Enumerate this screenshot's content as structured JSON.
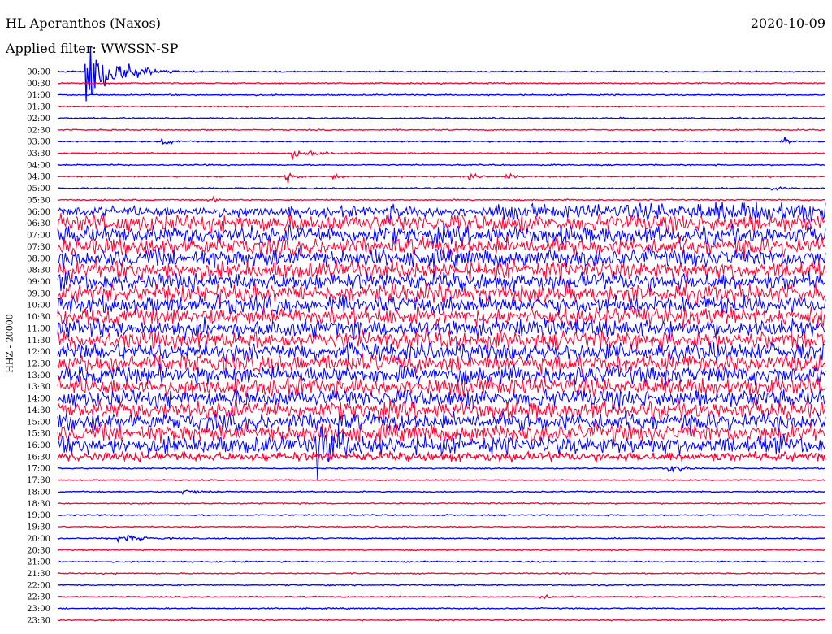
{
  "header": {
    "title": "HL Aperanthos (Naxos)",
    "filter_label": "Applied filter:",
    "filter_value": "WWSSN-SP",
    "date": "2020-10-09"
  },
  "chart_data": {
    "type": "line",
    "title": "HL Aperanthos (Naxos)",
    "date": "2020-10-09",
    "filter": "WWSSN-SP",
    "ylabel": "HHZ - 20000",
    "xlabel": "",
    "row_labels": [
      "00:00",
      "00:30",
      "01:00",
      "01:30",
      "02:00",
      "02:30",
      "03:00",
      "03:30",
      "04:00",
      "04:30",
      "05:00",
      "05:30",
      "06:00",
      "06:30",
      "07:00",
      "07:30",
      "08:00",
      "08:30",
      "09:00",
      "09:30",
      "10:00",
      "10:30",
      "11:00",
      "11:30",
      "12:00",
      "12:30",
      "13:00",
      "13:30",
      "14:00",
      "14:30",
      "15:00",
      "15:30",
      "16:00",
      "16:30",
      "17:00",
      "17:30",
      "18:00",
      "18:30",
      "19:00",
      "19:30",
      "20:00",
      "20:30",
      "21:00",
      "21:30",
      "22:00",
      "22:30",
      "23:00",
      "23:30"
    ],
    "row_interval_minutes": 30,
    "line_colors": [
      "#0000ff",
      "#ff0033"
    ],
    "noisy_rows": [
      {
        "start": "06:00",
        "end": "16:30",
        "amplitude": 1.0
      }
    ],
    "events": [
      {
        "row": "00:00",
        "minute": 1.2,
        "amplitude": 4.2,
        "duration_min": 1.5
      },
      {
        "row": "03:00",
        "minute": 4.2,
        "amplitude": 0.35,
        "duration_min": 0.5
      },
      {
        "row": "03:00",
        "minute": 28.4,
        "amplitude": 0.45,
        "duration_min": 0.3
      },
      {
        "row": "03:30",
        "minute": 9.3,
        "amplitude": 0.55,
        "duration_min": 1.2
      },
      {
        "row": "04:30",
        "minute": 9.0,
        "amplitude": 0.6,
        "duration_min": 0.3
      },
      {
        "row": "04:30",
        "minute": 10.9,
        "amplitude": 0.4,
        "duration_min": 0.3
      },
      {
        "row": "04:30",
        "minute": 16.2,
        "amplitude": 0.4,
        "duration_min": 0.3
      },
      {
        "row": "04:30",
        "minute": 17.6,
        "amplitude": 0.4,
        "duration_min": 0.3
      },
      {
        "row": "05:00",
        "minute": 28.0,
        "amplitude": 0.25,
        "duration_min": 0.5
      },
      {
        "row": "05:30",
        "minute": 6.0,
        "amplitude": 0.3,
        "duration_min": 0.3
      },
      {
        "row": "06:00",
        "minute": 13.0,
        "amplitude": 0.4,
        "duration_min": 0.6
      },
      {
        "row": "06:00",
        "minute": 17.2,
        "amplitude": 0.5,
        "duration_min": 1.2
      },
      {
        "row": "16:00",
        "minute": 10.2,
        "amplitude": 2.5,
        "duration_min": 1.2
      },
      {
        "row": "17:00",
        "minute": 24.0,
        "amplitude": 0.5,
        "duration_min": 0.6
      },
      {
        "row": "18:00",
        "minute": 5.0,
        "amplitude": 0.25,
        "duration_min": 1.0
      },
      {
        "row": "20:00",
        "minute": 2.5,
        "amplitude": 0.45,
        "duration_min": 1.0
      },
      {
        "row": "22:30",
        "minute": 19.0,
        "amplitude": 0.2,
        "duration_min": 0.6
      }
    ]
  }
}
